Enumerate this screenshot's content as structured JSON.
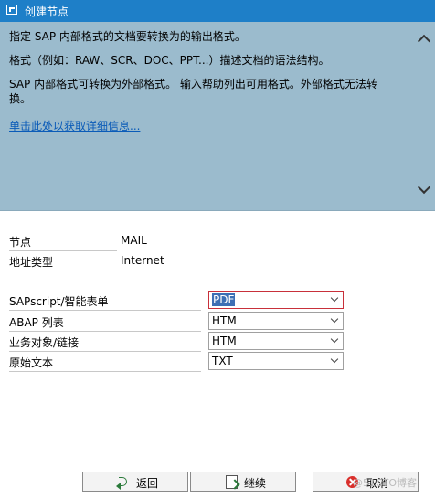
{
  "window": {
    "title": "创建节点"
  },
  "info": {
    "paragraphs": [
      "指定 SAP 内部格式的文档要转换为的输出格式。",
      "格式（例如：RAW、SCR、DOC、PPT...）描述文档的语法结构。",
      "SAP 内部格式可转换为外部格式。 输入帮助列出可用格式。外部格式无法转换。"
    ],
    "link": "单击此处以获取详细信息..."
  },
  "node": {
    "label": "节点",
    "value": "MAIL"
  },
  "address_type": {
    "label": "地址类型",
    "value": "Internet"
  },
  "formats": [
    {
      "label": "SAPscript/智能表单",
      "value": "PDF"
    },
    {
      "label": "ABAP 列表",
      "value": "HTM"
    },
    {
      "label": "业务对象/链接",
      "value": "HTM"
    },
    {
      "label": "原始文本",
      "value": "TXT"
    }
  ],
  "buttons": {
    "back": "返回",
    "next": "继续",
    "cancel": "取消"
  },
  "watermark": "@51CTO博客"
}
